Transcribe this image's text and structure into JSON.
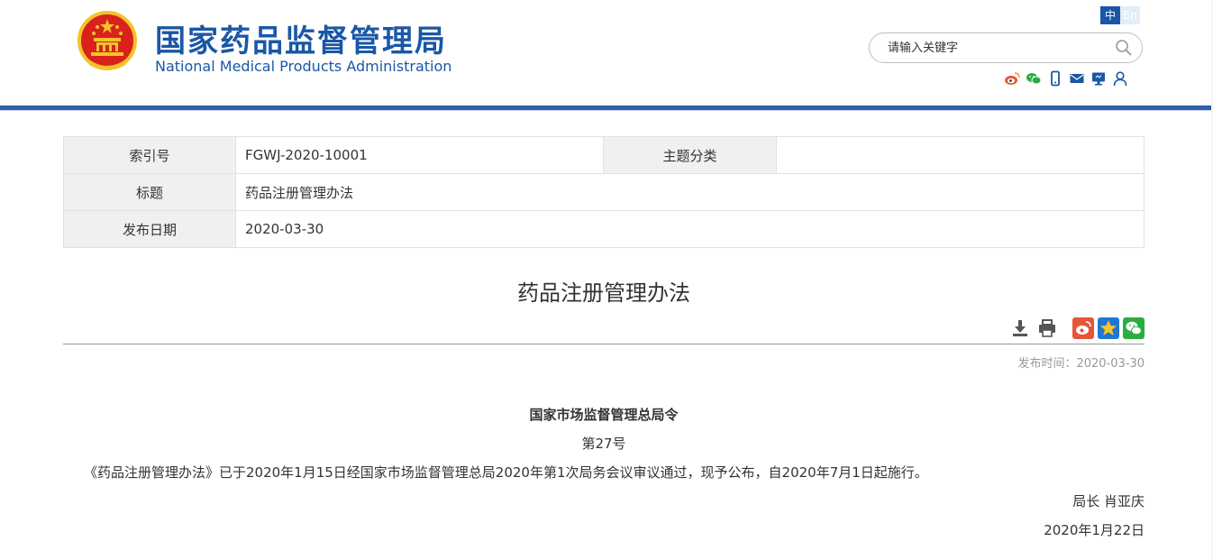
{
  "header": {
    "title_cn": "国家药品监督管理局",
    "title_en": "National Medical Products Administration",
    "lang_zh": "中",
    "lang_en": "En",
    "search": {
      "placeholder": "请输入关键字"
    },
    "social_icons": [
      "weibo-icon",
      "wechat-icon",
      "mobile-icon",
      "mail-icon",
      "monitor-icon",
      "user-icon"
    ]
  },
  "info": {
    "index_label": "索引号",
    "index_value": "FGWJ-2020-10001",
    "category_label": "主题分类",
    "category_value": "",
    "title_label": "标题",
    "title_value": "药品注册管理办法",
    "date_label": "发布日期",
    "date_value": "2020-03-30"
  },
  "article": {
    "title": "药品注册管理办法",
    "publish_time": "发布时间：2020-03-30",
    "issuer": "国家市场监督管理总局令",
    "number": "第27号",
    "paragraph": "《药品注册管理办法》已于2020年1月15日经国家市场监督管理总局2020年第1次局务会议审议通过，现予公布，自2020年7月1日起施行。",
    "signature": "局长 肖亚庆",
    "sign_date": "2020年1月22日"
  },
  "colors": {
    "brand_blue": "#1a57a6",
    "bar_blue": "#2f5fa6",
    "weibo": "#e6553a",
    "wechat": "#2aae3f",
    "qzone": "#1f77d4"
  }
}
